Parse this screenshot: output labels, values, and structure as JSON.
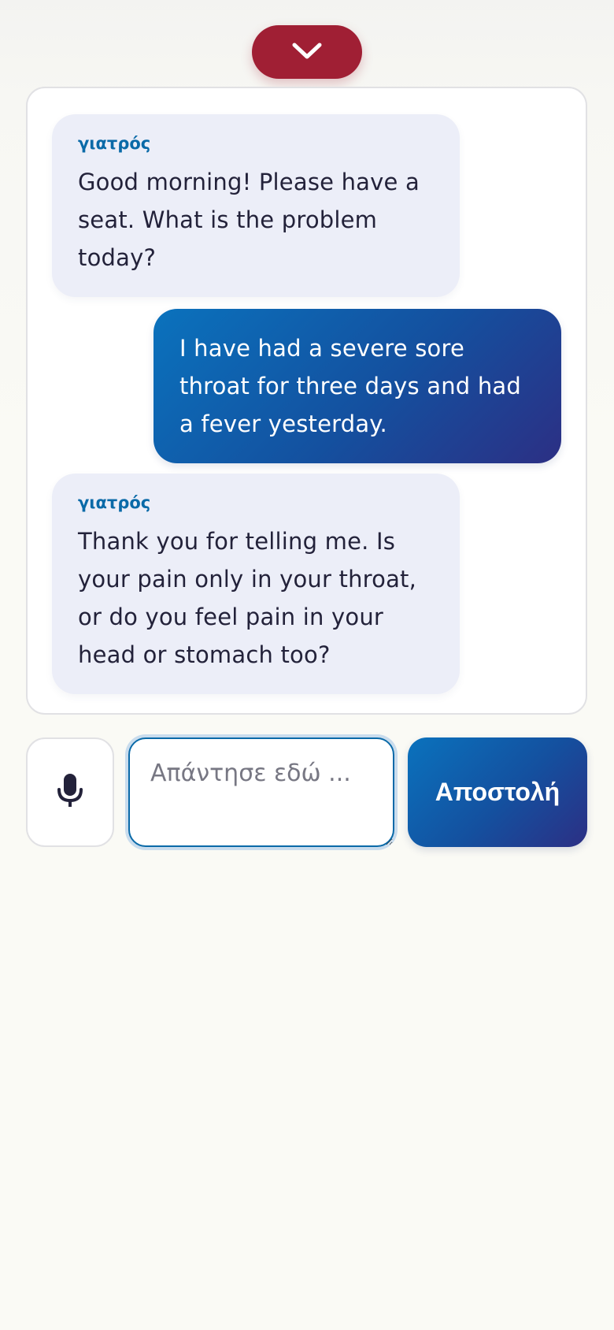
{
  "top": {
    "collapse_icon": "chevron-down-icon"
  },
  "chat": {
    "messages": [
      {
        "role": "bot",
        "sender": "γιατρός",
        "text": "Good morning! Please have a seat. What is the problem today?"
      },
      {
        "role": "user",
        "text": "I have had a severe sore throat for three days and had a fever yesterday."
      },
      {
        "role": "bot",
        "sender": "γιατρός",
        "text": "Thank you for telling me. Is your pain only in your throat, or do you feel pain in your head or stomach too?"
      }
    ]
  },
  "composer": {
    "mic_icon": "microphone-icon",
    "input_value": "",
    "input_placeholder": "Απάντησε εδώ ...",
    "send_label": "Αποστολή"
  },
  "colors": {
    "accent_red": "#a01f34",
    "accent_blue": "#0a6aa8",
    "gradient_start": "#0a72bd",
    "gradient_end": "#2c2f84",
    "bot_bubble": "#eceef8"
  }
}
